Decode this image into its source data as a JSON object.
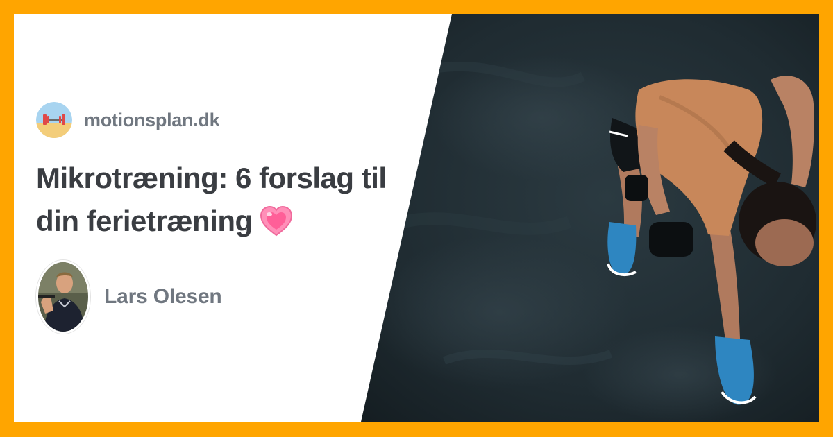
{
  "site": {
    "name": "motionsplan.dk",
    "logo_icon": "barbell-logo-icon"
  },
  "article": {
    "title_line1": "Mikrotræning: 6 forslag til",
    "title_line2": "din ferietræning",
    "emoji_icon": "pink-heart-icon"
  },
  "author": {
    "name": "Lars Olesen",
    "avatar_icon": "author-avatar"
  },
  "colors": {
    "border": "#ffa500",
    "card": "#ffffff",
    "title_text": "#3a3d42",
    "muted_text": "#707780",
    "photo_floor": "#1f2a30",
    "shirt": "#c8875a",
    "shoe": "#2e86c1"
  }
}
